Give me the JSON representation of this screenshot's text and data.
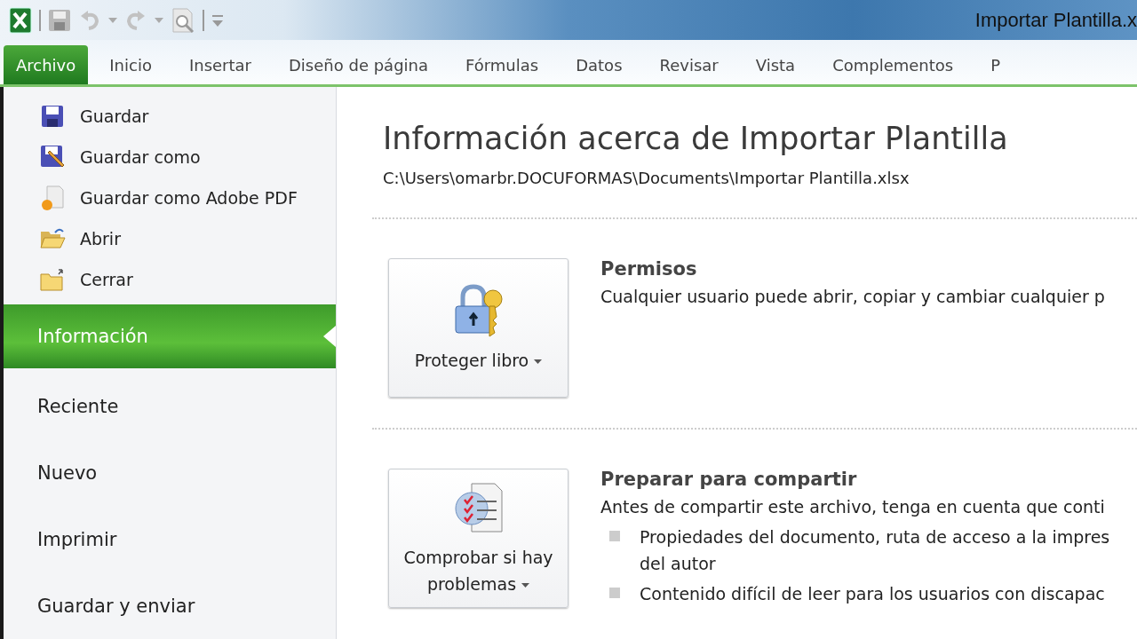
{
  "window": {
    "title": "Importar Plantilla.x"
  },
  "ribbon_tabs": [
    {
      "label": "Archivo",
      "selected": true
    },
    {
      "label": "Inicio",
      "selected": false
    },
    {
      "label": "Insertar",
      "selected": false
    },
    {
      "label": "Diseño de página",
      "selected": false
    },
    {
      "label": "Fórmulas",
      "selected": false
    },
    {
      "label": "Datos",
      "selected": false
    },
    {
      "label": "Revisar",
      "selected": false
    },
    {
      "label": "Vista",
      "selected": false
    },
    {
      "label": "Complementos",
      "selected": false
    },
    {
      "label": "P",
      "selected": false
    }
  ],
  "backstage_menu": [
    {
      "label": "Guardar",
      "kind": "command",
      "selected": false
    },
    {
      "label": "Guardar como",
      "kind": "command",
      "selected": false
    },
    {
      "label": "Guardar como Adobe PDF",
      "kind": "command",
      "selected": false
    },
    {
      "label": "Abrir",
      "kind": "command",
      "selected": false
    },
    {
      "label": "Cerrar",
      "kind": "command",
      "selected": false
    },
    {
      "label": "Información",
      "kind": "page",
      "selected": true
    },
    {
      "label": "Reciente",
      "kind": "page",
      "selected": false
    },
    {
      "label": "Nuevo",
      "kind": "page",
      "selected": false
    },
    {
      "label": "Imprimir",
      "kind": "page",
      "selected": false
    },
    {
      "label": "Guardar y enviar",
      "kind": "page",
      "selected": false
    }
  ],
  "info": {
    "title": "Información acerca de Importar Plantilla",
    "path": "C:\\Users\\omarbr.DOCUFORMAS\\Documents\\Importar Plantilla.xlsx",
    "sections": [
      {
        "button": "Proteger libro",
        "heading": "Permisos",
        "description": "Cualquier usuario puede abrir, copiar y cambiar cualquier p"
      },
      {
        "button": "Comprobar si hay problemas",
        "heading": "Preparar para compartir",
        "description": "Antes de compartir este archivo, tenga en cuenta que conti",
        "bullets": [
          "Propiedades del documento, ruta de acceso a la impres del autor",
          "Contenido difícil de leer para los usuarios con discapac"
        ]
      }
    ]
  }
}
